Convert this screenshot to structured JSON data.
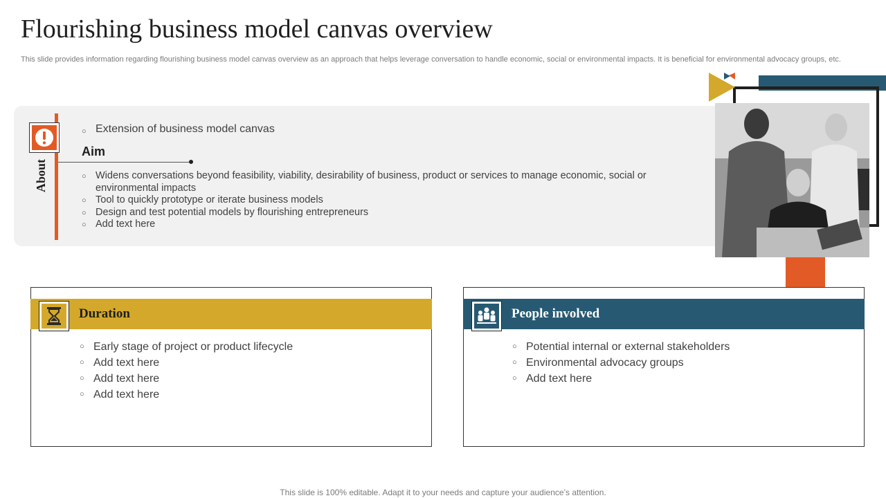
{
  "slide": {
    "title": "Flourishing business model canvas overview",
    "description": "This slide provides information regarding flourishing business model canvas overview as an approach that helps leverage conversation to handle economic, social or environmental impacts. It is beneficial for environmental advocacy groups, etc.",
    "footer": "This slide is 100% editable. Adapt it to your needs and capture your audience’s attention."
  },
  "about": {
    "label": "About",
    "icon": "exclamation-icon",
    "extension": "Extension of business model canvas",
    "aim_heading": "Aim",
    "aim_items": [
      "Widens conversations beyond feasibility, viability, desirability of business, product or services to manage economic, social or environmental impacts",
      "Tool to quickly prototype or iterate business models",
      "Design and test potential models by flourishing entrepreneurs",
      "Add text here"
    ]
  },
  "duration": {
    "title": "Duration",
    "icon": "hourglass-icon",
    "items": [
      "Early stage of project or product lifecycle",
      "Add text here",
      "Add text here",
      "Add text here"
    ]
  },
  "people": {
    "title": "People involved",
    "icon": "people-group-icon",
    "items": [
      "Potential internal or external stakeholders",
      "Environmental advocacy groups",
      "Add text here"
    ]
  },
  "colors": {
    "orange": "#e25b27",
    "gold": "#d4a82a",
    "teal": "#275a72"
  }
}
